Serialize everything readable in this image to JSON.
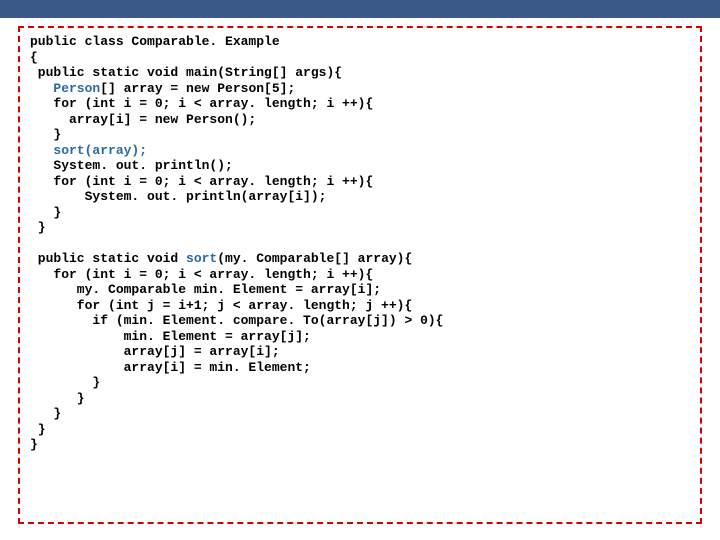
{
  "code": {
    "l01a": "public class Comparable. Example",
    "l02": "{",
    "l03": " public static void main(String[] args){",
    "l04a": "   ",
    "l04b": "Person",
    "l04c": "[] array = new Person[5];",
    "l05": "   for (int i = 0; i < array. length; i ++){",
    "l06": "     array[i] = new Person();",
    "l07": "   }",
    "l08a": "   ",
    "l08b": "sort(array);",
    "l09": "   System. out. println();",
    "l10": "   for (int i = 0; i < array. length; i ++){",
    "l11": "       System. out. println(array[i]);",
    "l12": "   }",
    "l13": " }",
    "blank1": "",
    "l15a": " public static void ",
    "l15b": "sort",
    "l15c": "(my. Comparable[] array){",
    "l16": "   for (int i = 0; i < array. length; i ++){",
    "l17": "      my. Comparable min. Element = array[i];",
    "l18": "      for (int j = i+1; j < array. length; j ++){",
    "l19": "        if (min. Element. compare. To(array[j]) > 0){",
    "l20": "            min. Element = array[j];",
    "l21": "            array[j] = array[i];",
    "l22": "            array[i] = min. Element;",
    "l23": "        }",
    "l24": "      }",
    "l25": "   }",
    "l26": " }",
    "l27": "}"
  }
}
